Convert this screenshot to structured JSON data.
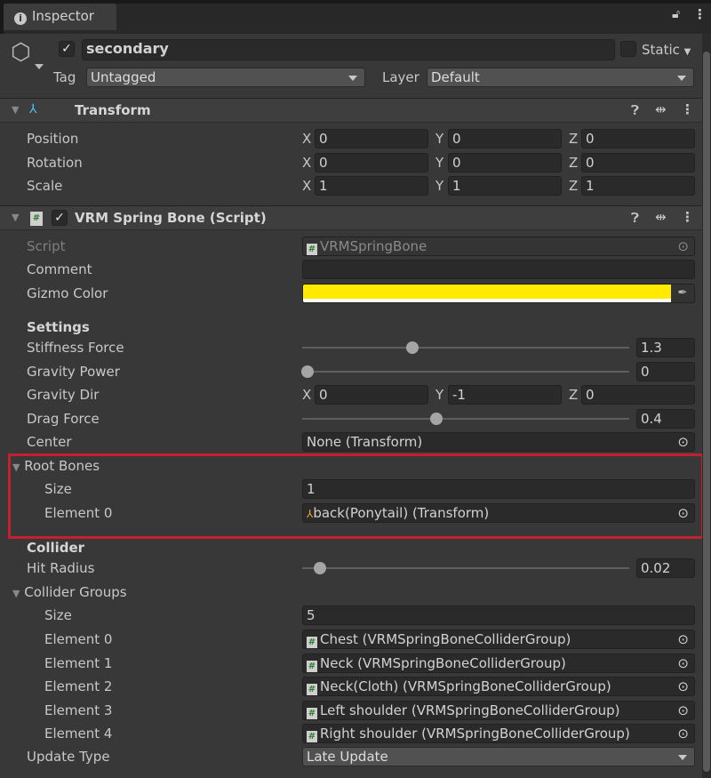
{
  "window": {
    "tab": "Inspector"
  },
  "object": {
    "name": "secondary",
    "active": true,
    "static_label": "Static",
    "tag_label": "Tag",
    "tag": "Untagged",
    "layer_label": "Layer",
    "layer": "Default"
  },
  "transform": {
    "title": "Transform",
    "rows": [
      {
        "label": "Position",
        "x": "0",
        "y": "0",
        "z": "0"
      },
      {
        "label": "Rotation",
        "x": "0",
        "y": "0",
        "z": "0"
      },
      {
        "label": "Scale",
        "x": "1",
        "y": "1",
        "z": "1"
      }
    ]
  },
  "axes": {
    "x": "X",
    "y": "Y",
    "z": "Z"
  },
  "spring": {
    "title": "VRM Spring Bone (Script)",
    "script_label": "Script",
    "script": "VRMSpringBone",
    "comment_label": "Comment",
    "comment": "",
    "gizmo_label": "Gizmo Color",
    "gizmo_color": "#ffea00",
    "settings": "Settings",
    "stiffness_label": "Stiffness Force",
    "stiffness": "1.3",
    "stiffness_min": 0,
    "stiffness_max": 4,
    "gravity_power_label": "Gravity Power",
    "gravity_power": "0",
    "gravity_power_min": 0,
    "gravity_power_max": 1,
    "gravity_dir_label": "Gravity Dir",
    "gravity_dir": {
      "x": "0",
      "y": "-1",
      "z": "0"
    },
    "drag_label": "Drag Force",
    "drag": "0.4",
    "drag_min": 0,
    "drag_max": 1,
    "center_label": "Center",
    "center": "None (Transform)",
    "root_bones": {
      "label": "Root Bones",
      "size_label": "Size",
      "size": "1",
      "elements": [
        {
          "label": "Element 0",
          "value": "back(Ponytail) (Transform)"
        }
      ]
    },
    "collider": "Collider",
    "hit_radius_label": "Hit Radius",
    "hit_radius": "0.02",
    "hit_radius_min": 0,
    "hit_radius_max": 0.5,
    "collider_groups": {
      "label": "Collider Groups",
      "size_label": "Size",
      "size": "5",
      "elements": [
        {
          "label": "Element 0",
          "value": "Chest (VRMSpringBoneColliderGroup)"
        },
        {
          "label": "Element 1",
          "value": "Neck (VRMSpringBoneColliderGroup)"
        },
        {
          "label": "Element 2",
          "value": "Neck(Cloth) (VRMSpringBoneColliderGroup)"
        },
        {
          "label": "Element 3",
          "value": "Left shoulder (VRMSpringBoneColliderGroup)"
        },
        {
          "label": "Element 4",
          "value": "Right shoulder (VRMSpringBoneColliderGroup)"
        }
      ]
    },
    "update_type_label": "Update Type",
    "update_type": "Late Update"
  },
  "icons": {
    "lock": "lock-icon",
    "menu": "kebab-menu-icon",
    "help": "help-icon",
    "presets": "presets-icon",
    "picker": "object-picker-icon",
    "eyedropper": "eyedropper-icon"
  }
}
